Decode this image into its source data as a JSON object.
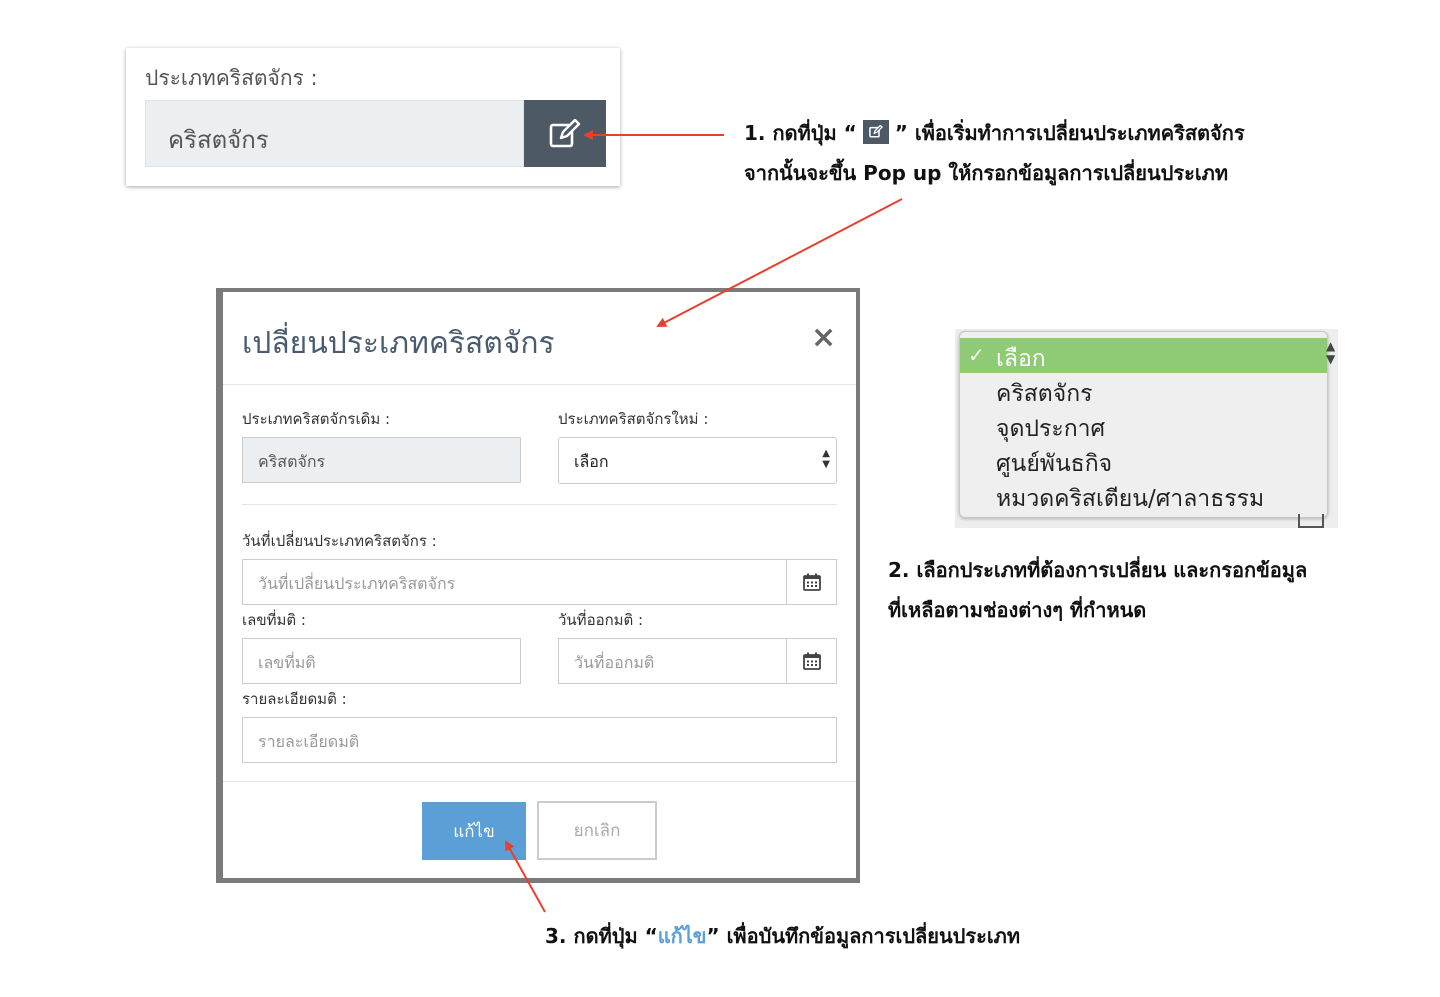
{
  "panel1": {
    "label": "ประเภทคริสตจักร :",
    "value": "คริสตจักร",
    "edit_icon": "edit-icon"
  },
  "note1": {
    "line1_prefix": "1. กดที่ปุ่ม “",
    "line1_suffix": "” เพื่อเริ่มทำการเปลี่ยนประเภทคริสตจักร",
    "line2": "จากนั้นจะขึ้น Pop up ให้กรอกข้อมูลการเปลี่ยนประเภท"
  },
  "modal": {
    "title": "เปลี่ยนประเภทคริสตจักร",
    "close": "×",
    "old_type_label": "ประเภทคริสตจักรเดิม :",
    "old_type_value": "คริสตจักร",
    "new_type_label": "ประเภทคริสตจักรใหม่ :",
    "new_type_value": "เลือก",
    "change_date_label": "วันที่เปลี่ยนประเภทคริสตจักร :",
    "change_date_placeholder": "วันที่เปลี่ยนประเภทคริสตจักร",
    "resolution_no_label": "เลขที่มติ :",
    "resolution_no_placeholder": "เลขที่มติ",
    "resolution_date_label": "วันที่ออกมติ :",
    "resolution_date_placeholder": "วันที่ออกมติ",
    "detail_label": "รายละเอียดมติ :",
    "detail_placeholder": "รายละเอียดมติ",
    "save_label": "แก้ไข",
    "cancel_label": "ยกเลิก",
    "accent_color": "#5b9fd6"
  },
  "dropdown": {
    "options": [
      "เลือก",
      "คริสตจักร",
      "จุดประกาศ",
      "ศูนย์พันธกิจ",
      "หมวดคริสเตียน/ศาลาธรรม"
    ],
    "selected_mark": "✓",
    "selected_color": "#8fca74"
  },
  "note2": {
    "line1": "2. เลือกประเภทที่ต้องการเปลี่ยน และกรอกข้อมูล",
    "line2": "ที่เหลือตามช่องต่างๆ ที่กำหนด"
  },
  "note3": {
    "prefix": "3. กดที่ปุ่ม “",
    "highlight": "แก้ไข",
    "suffix": "” เพื่อบันทึกข้อมูลการเปลี่ยนประเภท",
    "highlight_color": "#5b9fd6"
  },
  "arrow_color": "#e8402f"
}
